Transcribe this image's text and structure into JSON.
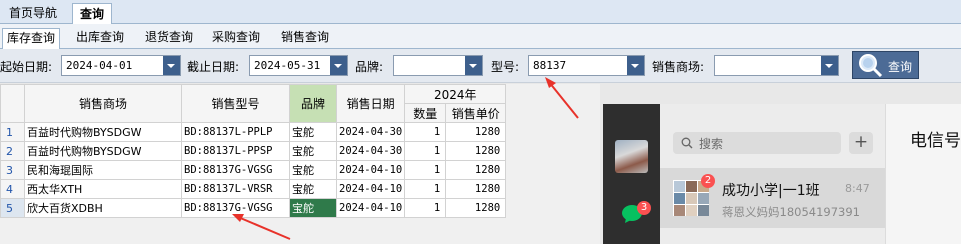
{
  "top_tabs": [
    "首页导航",
    "查询"
  ],
  "sub_tabs": [
    "库存查询",
    "出库查询",
    "退货查询",
    "采购查询",
    "销售查询"
  ],
  "filters": {
    "start_label": "起始日期:",
    "start_value": "2024-04-01",
    "end_label": "截止日期:",
    "end_value": "2024-05-31",
    "brand_label": "品牌:",
    "brand_value": "",
    "model_label": "型号:",
    "model_value": "88137",
    "mall_label": "销售商场:",
    "mall_value": "",
    "search_label": "查询"
  },
  "table": {
    "headers": {
      "mall": "销售商场",
      "model": "销售型号",
      "brand": "品牌",
      "date": "销售日期",
      "group": "2024年",
      "qty": "数量",
      "price": "销售单价"
    },
    "rows": [
      {
        "n": "1",
        "mall": "百益时代购物BYSDGW",
        "model": "BD:88137L-PPLP",
        "brand": "宝舵",
        "date": "2024-04-30",
        "qty": "1",
        "price": "1280"
      },
      {
        "n": "2",
        "mall": "百益时代购物BYSDGW",
        "model": "BD:88137L-PPSP",
        "brand": "宝舵",
        "date": "2024-04-30",
        "qty": "1",
        "price": "1280"
      },
      {
        "n": "3",
        "mall": "民和海琨国际",
        "model": "BD:88137G-VGSG",
        "brand": "宝舵",
        "date": "2024-04-10",
        "qty": "1",
        "price": "1280"
      },
      {
        "n": "4",
        "mall": "西太华XTH",
        "model": "BD:88137L-VRSR",
        "brand": "宝舵",
        "date": "2024-04-10",
        "qty": "1",
        "price": "1280"
      },
      {
        "n": "5",
        "mall": "欣大百货XDBH",
        "model": "BD:88137G-VGSG",
        "brand": "宝舵",
        "date": "2024-04-10",
        "qty": "1",
        "price": "1280"
      }
    ]
  },
  "chat": {
    "rail_badge": "3",
    "search_placeholder": "搜索",
    "plus": "+",
    "conversation": {
      "title": "成功小学|一1班",
      "time": "8:47",
      "badge": "2",
      "preview": "蒋恩义妈妈18054197391"
    },
    "pane_title": "电信号"
  },
  "colors": {
    "annotation_arrow": "#e8322a",
    "brand_header_green": "#c6e0b4",
    "selected_brand_cell": "#2f7a4a",
    "button_blue": "#4c6b96"
  }
}
